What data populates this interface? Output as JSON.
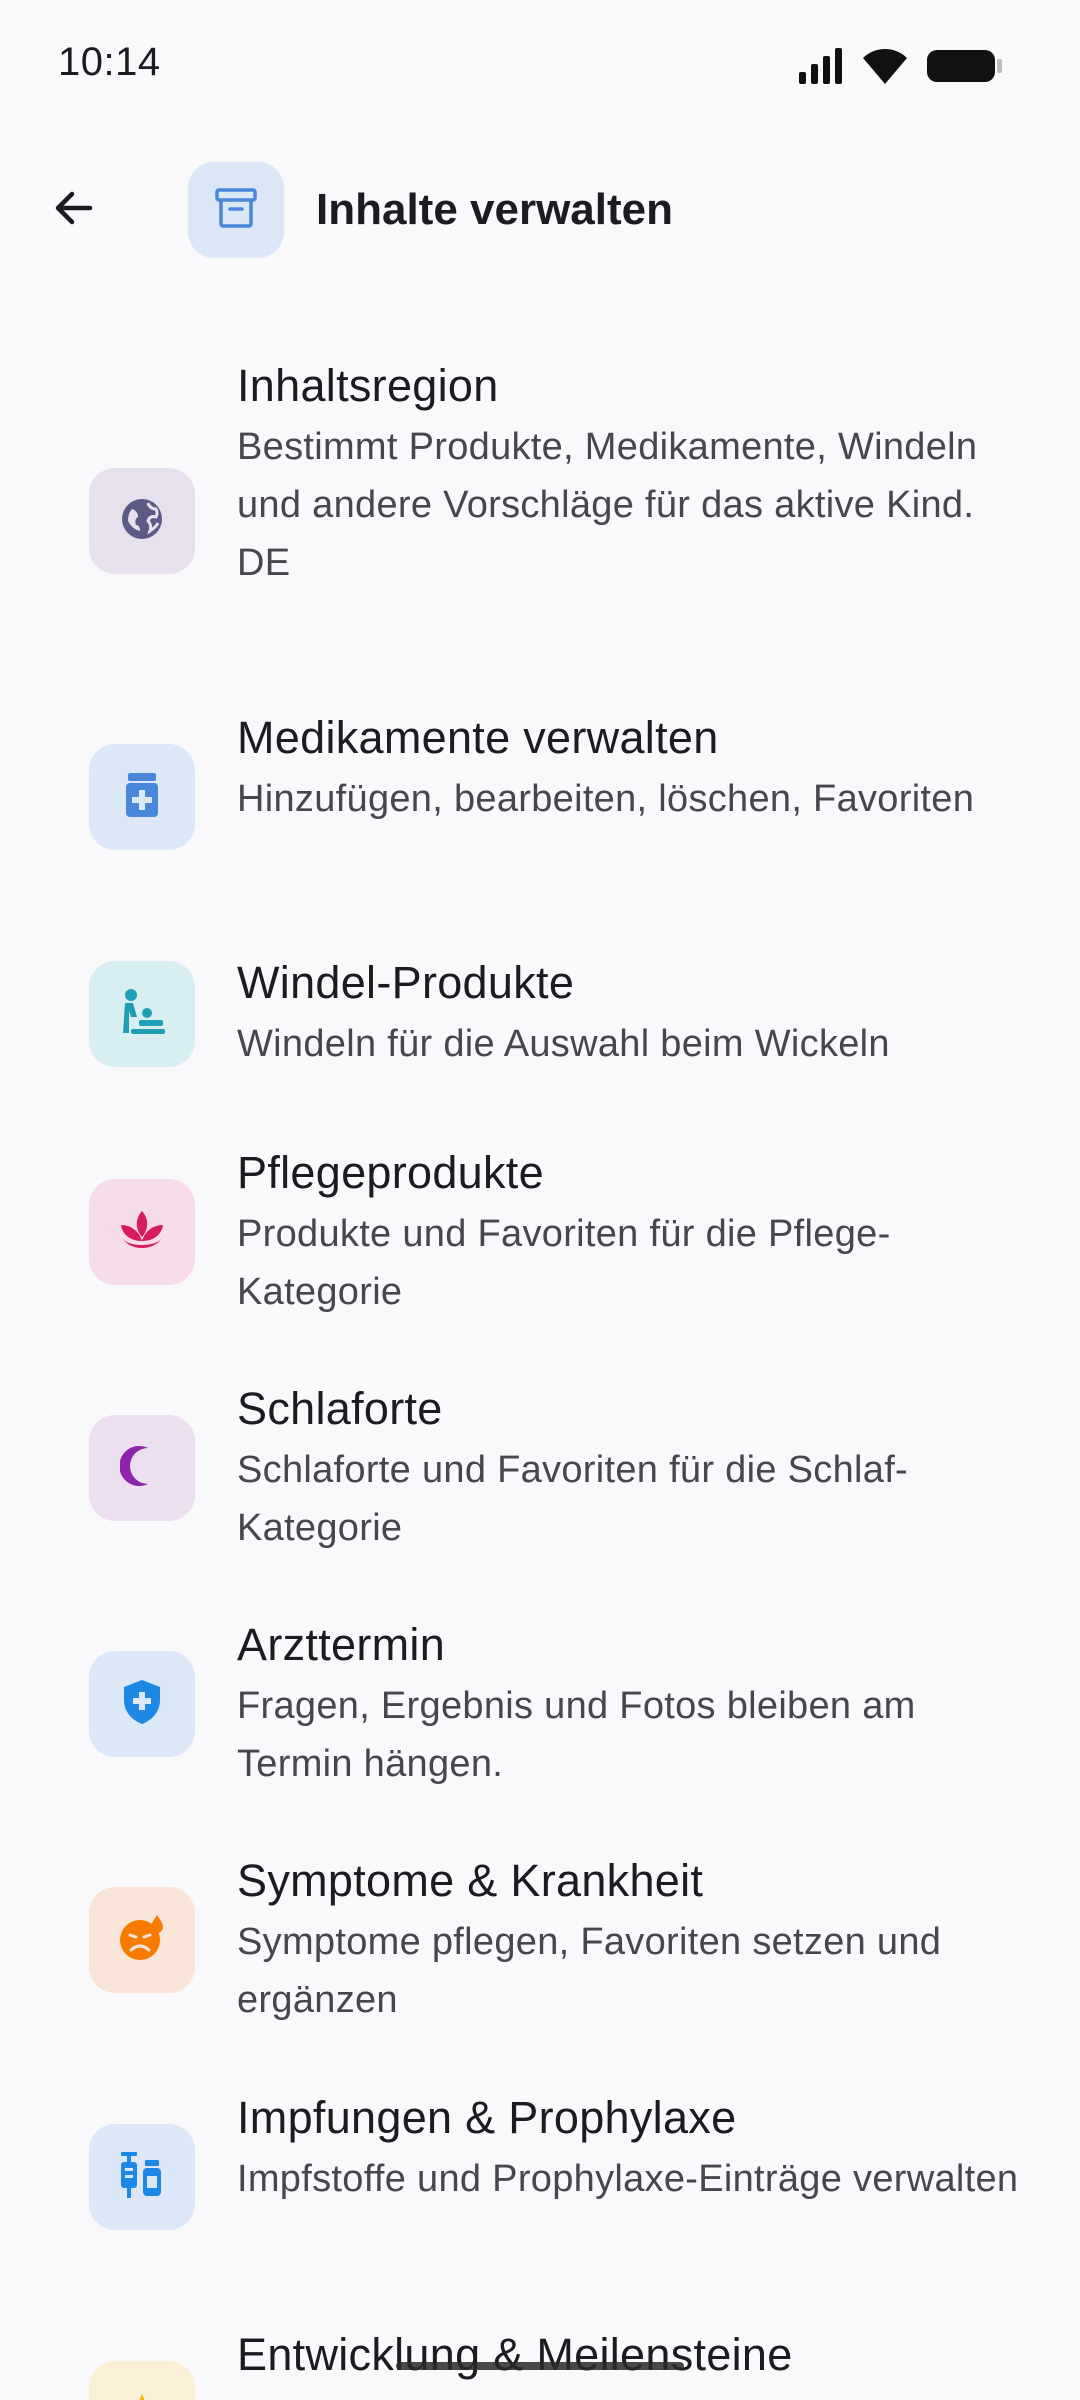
{
  "status": {
    "time": "10:14",
    "icons": [
      "signal-icon",
      "wifi-icon",
      "battery-icon"
    ]
  },
  "app_bar": {
    "title": "Inhalte verwalten",
    "back_icon": "arrow-back-icon",
    "title_icon": "archive-icon"
  },
  "items": [
    {
      "title": "Inhaltsregion",
      "subtitle": "Bestimmt Produkte, Medikamente, Windeln und andere Vorschläge für das aktive Kind.",
      "extra": "DE",
      "icon": "globe-icon",
      "icon_bg": "#e6e1ec",
      "icon_color": "#5d5a86"
    },
    {
      "title": "Medikamente verwalten",
      "subtitle": "Hinzufügen, bearbeiten, löschen, Favoriten",
      "icon": "medication-icon",
      "icon_bg": "#dce7f8",
      "icon_color": "#4a86d9"
    },
    {
      "title": "Windel-Produkte",
      "subtitle": "Windeln für die Auswahl beim Wickeln",
      "icon": "baby-changing-icon",
      "icon_bg": "#d8eef3",
      "icon_color": "#1f9fb3"
    },
    {
      "title": "Pflegeprodukte",
      "subtitle": "Produkte und Favoriten für die Pflege-Kategorie",
      "icon": "spa-icon",
      "icon_bg": "#f6dbe8",
      "icon_color": "#d81b60"
    },
    {
      "title": "Schlaforte",
      "subtitle": "Schlaforte und Favoriten für die Schlaf-Kategorie",
      "icon": "moon-icon",
      "icon_bg": "#ecdff0",
      "icon_color": "#8e24aa"
    },
    {
      "title": "Arzttermin",
      "subtitle": "Fragen, Ergebnis und Fotos bleiben am Termin hängen.",
      "icon": "shield-plus-icon",
      "icon_bg": "#dce7f8",
      "icon_color": "#1e88e5"
    },
    {
      "title": "Symptome & Krankheit",
      "subtitle": "Symptome pflegen, Favoriten setzen und ergänzen",
      "icon": "sick-face-icon",
      "icon_bg": "#f9e4d8",
      "icon_color": "#f57c00"
    },
    {
      "title": "Impfungen & Prophylaxe",
      "subtitle": "Impfstoffe und Prophylaxe-Einträge verwalten",
      "icon": "vaccine-icon",
      "icon_bg": "#dce7f8",
      "icon_color": "#1e88e5"
    },
    {
      "title": "Entwicklung & Meilensteine",
      "icon": "milestone-icon",
      "icon_bg": "#fbefd6",
      "icon_color": "#f5b400"
    }
  ]
}
